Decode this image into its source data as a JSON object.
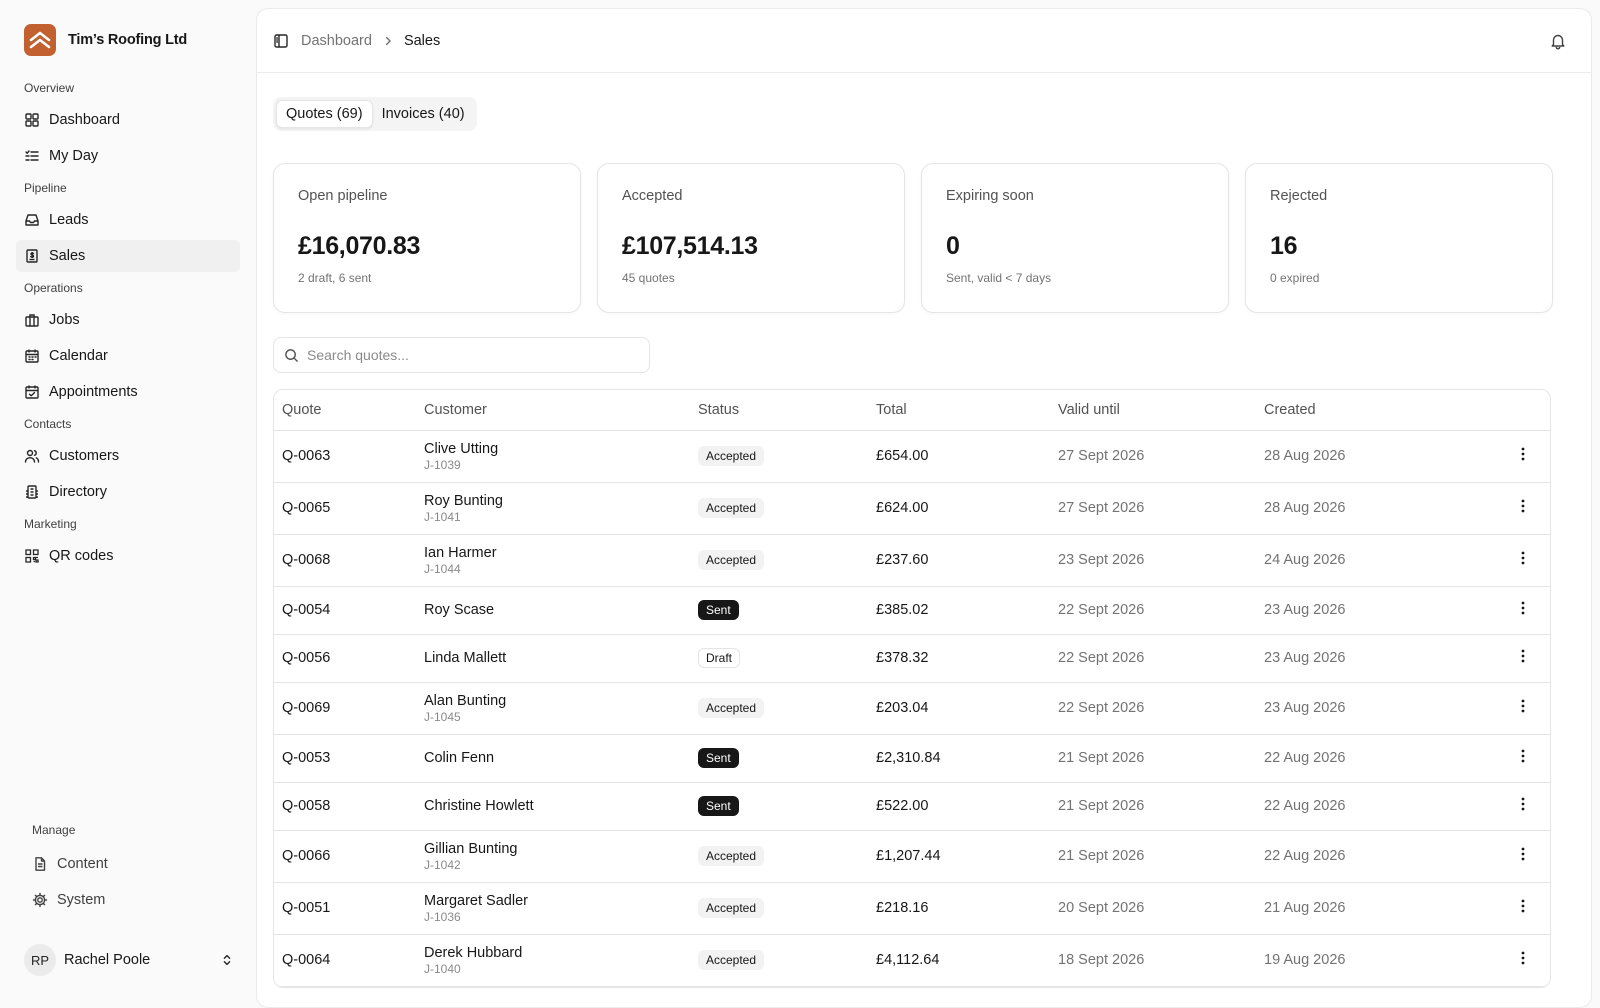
{
  "brand": {
    "name": "Tim’s Roofing Ltd",
    "logo_icon": "roof-chevrons-icon",
    "color": "#c2602f"
  },
  "nav": {
    "overview": "Overview",
    "dashboard": "Dashboard",
    "my_day": "My Day",
    "pipeline": "Pipeline",
    "leads": "Leads",
    "sales": "Sales",
    "operations": "Operations",
    "jobs": "Jobs",
    "calendar": "Calendar",
    "appointments": "Appointments",
    "contacts": "Contacts",
    "customers": "Customers",
    "directory": "Directory",
    "marketing": "Marketing",
    "qr_codes": "QR codes",
    "manage": "Manage",
    "content": "Content",
    "system": "System"
  },
  "user": {
    "initials": "RP",
    "name": "Rachel Poole"
  },
  "breadcrumb": {
    "parent": "Dashboard",
    "current": "Sales"
  },
  "tabs": {
    "quotes": "Quotes (69)",
    "invoices": "Invoices (40)"
  },
  "cards": [
    {
      "title": "Open pipeline",
      "value": "£16,070.83",
      "sub": "2 draft, 6 sent"
    },
    {
      "title": "Accepted",
      "value": "£107,514.13",
      "sub": "45 quotes"
    },
    {
      "title": "Expiring soon",
      "value": "0",
      "sub": "Sent, valid < 7 days"
    },
    {
      "title": "Rejected",
      "value": "16",
      "sub": "0 expired"
    }
  ],
  "search": {
    "placeholder": "Search quotes..."
  },
  "table": {
    "headers": {
      "quote": "Quote",
      "customer": "Customer",
      "status": "Status",
      "total": "Total",
      "valid": "Valid until",
      "created": "Created"
    },
    "rows": [
      {
        "quote": "Q-0063",
        "customer": "Clive Utting",
        "job": "J-1039",
        "status": "Accepted",
        "total": "£654.00",
        "valid": "27 Sept 2026",
        "created": "28 Aug 2026"
      },
      {
        "quote": "Q-0065",
        "customer": "Roy Bunting",
        "job": "J-1041",
        "status": "Accepted",
        "total": "£624.00",
        "valid": "27 Sept 2026",
        "created": "28 Aug 2026"
      },
      {
        "quote": "Q-0068",
        "customer": "Ian Harmer",
        "job": "J-1044",
        "status": "Accepted",
        "total": "£237.60",
        "valid": "23 Sept 2026",
        "created": "24 Aug 2026"
      },
      {
        "quote": "Q-0054",
        "customer": "Roy Scase",
        "job": "",
        "status": "Sent",
        "total": "£385.02",
        "valid": "22 Sept 2026",
        "created": "23 Aug 2026"
      },
      {
        "quote": "Q-0056",
        "customer": "Linda Mallett",
        "job": "",
        "status": "Draft",
        "total": "£378.32",
        "valid": "22 Sept 2026",
        "created": "23 Aug 2026"
      },
      {
        "quote": "Q-0069",
        "customer": "Alan Bunting",
        "job": "J-1045",
        "status": "Accepted",
        "total": "£203.04",
        "valid": "22 Sept 2026",
        "created": "23 Aug 2026"
      },
      {
        "quote": "Q-0053",
        "customer": "Colin Fenn",
        "job": "",
        "status": "Sent",
        "total": "£2,310.84",
        "valid": "21 Sept 2026",
        "created": "22 Aug 2026"
      },
      {
        "quote": "Q-0058",
        "customer": "Christine Howlett",
        "job": "",
        "status": "Sent",
        "total": "£522.00",
        "valid": "21 Sept 2026",
        "created": "22 Aug 2026"
      },
      {
        "quote": "Q-0066",
        "customer": "Gillian Bunting",
        "job": "J-1042",
        "status": "Accepted",
        "total": "£1,207.44",
        "valid": "21 Sept 2026",
        "created": "22 Aug 2026"
      },
      {
        "quote": "Q-0051",
        "customer": "Margaret Sadler",
        "job": "J-1036",
        "status": "Accepted",
        "total": "£218.16",
        "valid": "20 Sept 2026",
        "created": "21 Aug 2026"
      },
      {
        "quote": "Q-0064",
        "customer": "Derek Hubbard",
        "job": "J-1040",
        "status": "Accepted",
        "total": "£4,112.64",
        "valid": "18 Sept 2026",
        "created": "19 Aug 2026"
      }
    ]
  }
}
